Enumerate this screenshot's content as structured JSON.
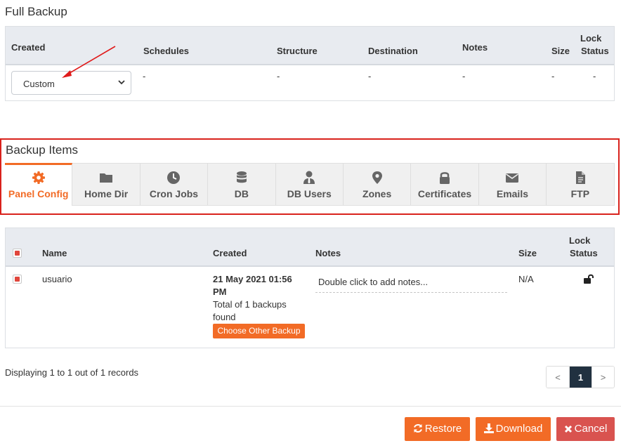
{
  "full_backup": {
    "title": "Full Backup",
    "columns": {
      "created": "Created",
      "schedules": "Schedules",
      "structure": "Structure",
      "destination": "Destination",
      "notes": "Notes",
      "size": "Size",
      "lock_line1": "Lock",
      "lock_line2": "Status"
    },
    "select_value": "Custom",
    "row": {
      "schedules": "-",
      "structure": "-",
      "destination": "-",
      "notes": "-",
      "size": "-",
      "lock": "-"
    }
  },
  "backup_items": {
    "title": "Backup Items",
    "tabs": [
      {
        "label": "Panel Config",
        "icon": "gear-icon",
        "active": true
      },
      {
        "label": "Home Dir",
        "icon": "folder-icon"
      },
      {
        "label": "Cron Jobs",
        "icon": "clock-icon"
      },
      {
        "label": "DB",
        "icon": "database-icon"
      },
      {
        "label": "DB Users",
        "icon": "user-tie-icon"
      },
      {
        "label": "Zones",
        "icon": "map-marker-icon"
      },
      {
        "label": "Certificates",
        "icon": "lock-icon"
      },
      {
        "label": "Emails",
        "icon": "envelope-icon"
      },
      {
        "label": "FTP",
        "icon": "file-icon"
      }
    ]
  },
  "records": {
    "columns": {
      "name": "Name",
      "created": "Created",
      "notes": "Notes",
      "size": "Size",
      "lock_line1": "Lock",
      "lock_line2": "Status"
    },
    "row": {
      "name": "usuario",
      "created_line1": "21 May 2021 01:56",
      "created_line2": "PM",
      "total_line1": "Total of 1 backups",
      "total_line2": "found",
      "choose_button": "Choose Other Backup",
      "notes_placeholder": "Double click to add notes...",
      "size": "N/A",
      "lock_icon": "unlock-icon"
    }
  },
  "pagination": {
    "summary": "Displaying 1 to 1 out of 1 records",
    "prev": "<",
    "current": "1",
    "next": ">"
  },
  "actions": {
    "restore": "Restore",
    "download": "Download",
    "cancel": "Cancel"
  },
  "colors": {
    "accent": "#f26b26",
    "danger": "#d9534f",
    "highlight_box": "#d9221c",
    "pager_active": "#213140"
  }
}
